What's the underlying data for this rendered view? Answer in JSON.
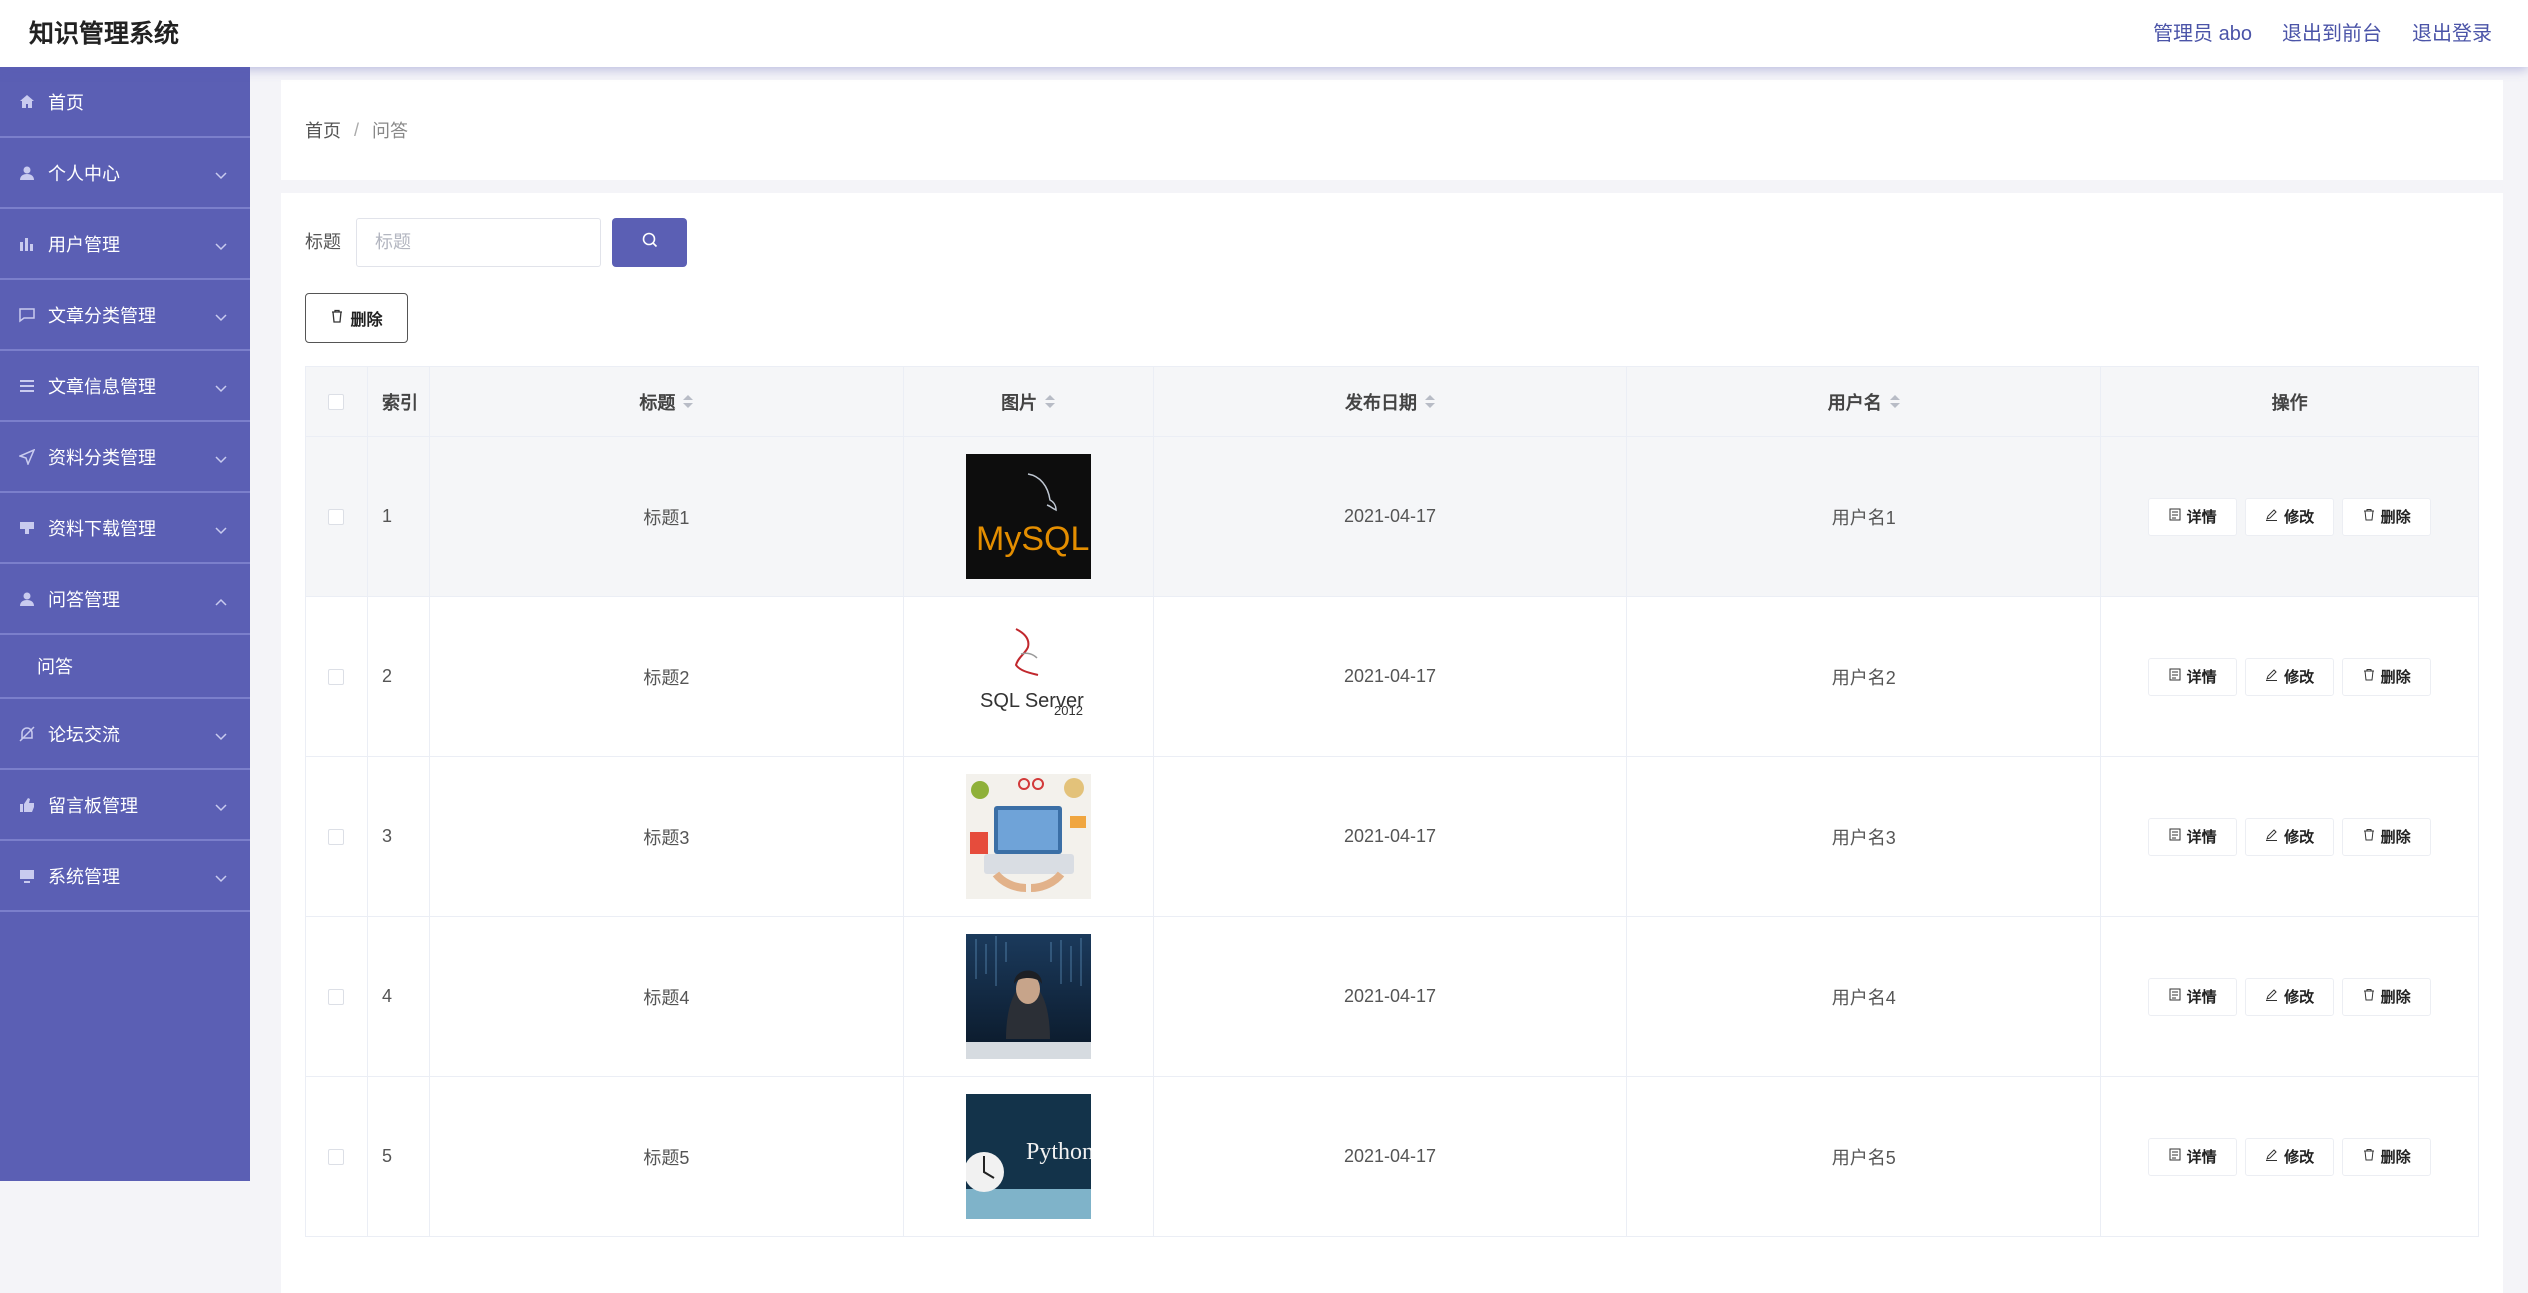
{
  "header": {
    "title": "知识管理系统",
    "admin": "管理员 abo",
    "to_front": "退出到前台",
    "logout": "退出登录"
  },
  "sidebar": {
    "items": [
      {
        "label": "首页",
        "icon": "home-icon"
      },
      {
        "label": "个人中心",
        "icon": "user-icon"
      },
      {
        "label": "用户管理",
        "icon": "bar-chart-icon"
      },
      {
        "label": "文章分类管理",
        "icon": "chat-icon"
      },
      {
        "label": "文章信息管理",
        "icon": "list-icon"
      },
      {
        "label": "资料分类管理",
        "icon": "send-icon"
      },
      {
        "label": "资料下载管理",
        "icon": "cup-icon"
      },
      {
        "label": "问答管理",
        "icon": "user-icon"
      },
      {
        "label": "论坛交流",
        "icon": "bell-off-icon"
      },
      {
        "label": "留言板管理",
        "icon": "thumb-icon"
      },
      {
        "label": "系统管理",
        "icon": "monitor-icon"
      }
    ],
    "sub_item": "问答"
  },
  "breadcrumb": {
    "home": "首页",
    "separator": "/",
    "current": "问答"
  },
  "search": {
    "label": "标题",
    "placeholder": "标题"
  },
  "toolbar": {
    "delete_label": "删除"
  },
  "table": {
    "headers": {
      "index": "索引",
      "title": "标题",
      "image": "图片",
      "date": "发布日期",
      "user": "用户名",
      "actions": "操作"
    },
    "actions": {
      "detail": "详情",
      "edit": "修改",
      "delete": "删除"
    },
    "rows": [
      {
        "index": "1",
        "title": "标题1",
        "image": "mysql-logo",
        "date": "2021-04-17",
        "user": "用户名1"
      },
      {
        "index": "2",
        "title": "标题2",
        "image": "sqlserver-logo",
        "date": "2021-04-17",
        "user": "用户名2"
      },
      {
        "index": "3",
        "title": "标题3",
        "image": "laptop-illustration",
        "date": "2021-04-17",
        "user": "用户名3"
      },
      {
        "index": "4",
        "title": "标题4",
        "image": "hacker-photo",
        "date": "2021-04-17",
        "user": "用户名4"
      },
      {
        "index": "5",
        "title": "标题5",
        "image": "python-book",
        "date": "2021-04-17",
        "user": "用户名5"
      }
    ]
  },
  "images": {
    "mysql_text": "MySQL",
    "sqlserver_text": "SQL Server",
    "sqlserver_year": "2012",
    "python_text": "Python"
  },
  "colors": {
    "accent": "#5b5fb4",
    "header_link": "#4b54a8"
  }
}
